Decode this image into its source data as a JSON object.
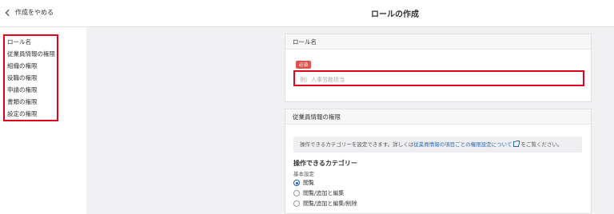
{
  "header": {
    "back_label": "作成をやめる",
    "title": "ロールの作成"
  },
  "sidebar": {
    "items": [
      {
        "label": "ロール名"
      },
      {
        "label": "従業員情報の権限"
      },
      {
        "label": "組織の権限"
      },
      {
        "label": "役職の権限"
      },
      {
        "label": "申請の権限"
      },
      {
        "label": "書類の権限"
      },
      {
        "label": "設定の権限"
      }
    ]
  },
  "role_name_card": {
    "header": "ロール名",
    "required_badge": "必須",
    "input_placeholder": "例）人事労務担当",
    "input_value": ""
  },
  "employee_card": {
    "header": "従業員情報の権限",
    "note_prefix": "操作できるカテゴリーを設定できます。詳しくは",
    "note_link": "従業員情報の項目ごとの権限設定について",
    "note_suffix": "をご覧ください。",
    "section_title": "操作できるカテゴリー",
    "subsection_title": "基本設定",
    "options": [
      {
        "label": "閲覧",
        "selected": true
      },
      {
        "label": "閲覧/追加と編集",
        "selected": false
      },
      {
        "label": "閲覧/追加と編集/削除",
        "selected": false
      }
    ]
  },
  "colors": {
    "highlight": "#e3001b",
    "link": "#2b6cb0",
    "radio_selected": "#1e5bbf",
    "badge": "#e0534d",
    "main_bg": "#f1f1f4"
  }
}
